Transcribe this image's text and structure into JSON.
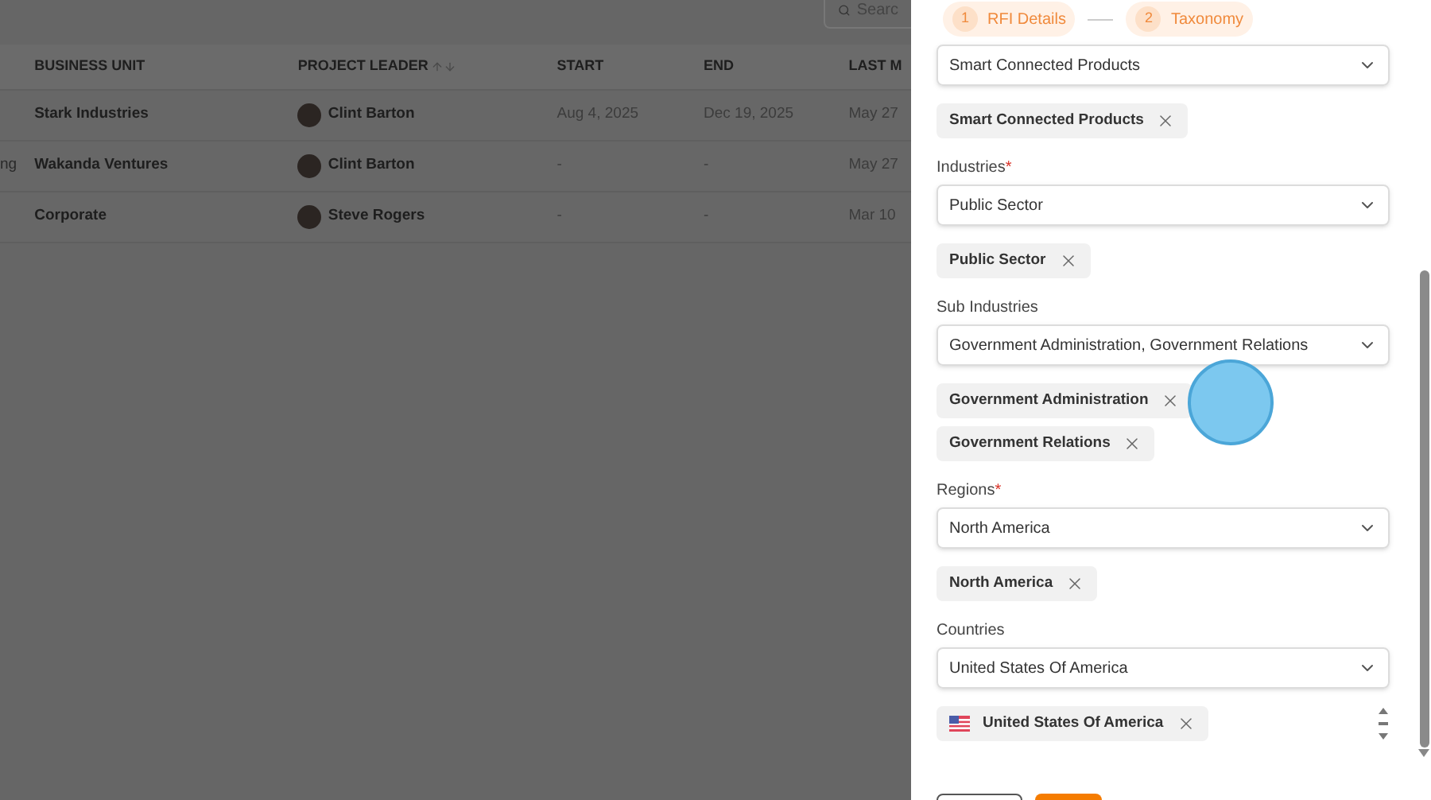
{
  "search": {
    "placeholder": "Searc"
  },
  "table": {
    "columns": [
      {
        "label": "BUSINESS UNIT"
      },
      {
        "label": "PROJECT LEADER",
        "sortable": true
      },
      {
        "label": "START"
      },
      {
        "label": "END"
      },
      {
        "label": "LAST M"
      }
    ],
    "rows": [
      {
        "business_unit": "Stark Industries",
        "leader": "Clint Barton",
        "start": "Aug 4, 2025",
        "end": "Dec 19, 2025",
        "last": "May 27"
      },
      {
        "column_1": "ng",
        "business_unit": "Wakanda Ventures",
        "leader": "Clint Barton",
        "start": "-",
        "end": "-",
        "last": "May 27"
      },
      {
        "business_unit": "Corporate",
        "leader": "Steve Rogers",
        "start": "-",
        "end": "-",
        "last": "Mar 10"
      }
    ]
  },
  "steps": [
    {
      "number": "1",
      "label": "RFI Details"
    },
    {
      "number": "2",
      "label": "Taxonomy"
    }
  ],
  "fields": [
    {
      "value": "Smart Connected Products",
      "chips": [
        {
          "kind": "text",
          "label": "Smart Connected Products"
        }
      ]
    },
    {
      "label": "Industries",
      "required_mark": "*",
      "value": "Public Sector",
      "chips": [
        {
          "kind": "text",
          "label": "Public Sector"
        }
      ]
    },
    {
      "label": "Sub Industries",
      "value": "Government Administration, Government Relations",
      "chips": [
        {
          "kind": "text",
          "label": "Government Administration"
        },
        {
          "kind": "text",
          "label": "Government Relations"
        }
      ]
    },
    {
      "label": "Regions",
      "required_mark": "*",
      "value": "North America",
      "chips": [
        {
          "kind": "text",
          "label": "North America"
        }
      ]
    },
    {
      "label": "Countries",
      "value": "United States Of America",
      "chips": [
        {
          "kind": "flag",
          "label": "United States Of America"
        }
      ]
    }
  ]
}
